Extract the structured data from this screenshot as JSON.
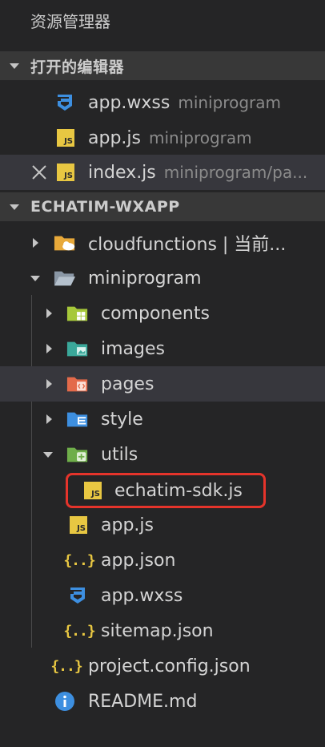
{
  "panel": {
    "title": "资源管理器"
  },
  "open_editors": {
    "section_label": "打开的编辑器",
    "items": [
      {
        "name": "app.wxss",
        "desc": "miniprogram",
        "icon": "css-file-icon"
      },
      {
        "name": "app.js",
        "desc": "miniprogram",
        "icon": "js-file-icon"
      },
      {
        "name": "index.js",
        "desc": "miniprogram/pa...",
        "icon": "js-file-icon"
      }
    ]
  },
  "workspace": {
    "section_label": "ECHATIM-WXAPP",
    "tree": [
      {
        "name": "cloudfunctions | 当前...",
        "type": "folder",
        "state": "collapsed",
        "icon": "cloud-folder-icon"
      },
      {
        "name": "miniprogram",
        "type": "folder",
        "state": "expanded",
        "icon": "folder-open-icon"
      },
      {
        "name": "components",
        "type": "folder",
        "state": "collapsed",
        "icon": "components-folder-icon"
      },
      {
        "name": "images",
        "type": "folder",
        "state": "collapsed",
        "icon": "images-folder-icon"
      },
      {
        "name": "pages",
        "type": "folder",
        "state": "collapsed",
        "icon": "pages-folder-icon"
      },
      {
        "name": "style",
        "type": "folder",
        "state": "collapsed",
        "icon": "style-folder-icon"
      },
      {
        "name": "utils",
        "type": "folder",
        "state": "expanded",
        "icon": "utils-folder-icon"
      },
      {
        "name": "echatim-sdk.js",
        "type": "file",
        "icon": "js-file-icon"
      },
      {
        "name": "app.js",
        "type": "file",
        "icon": "js-file-icon"
      },
      {
        "name": "app.json",
        "type": "file",
        "icon": "json-file-icon"
      },
      {
        "name": "app.wxss",
        "type": "file",
        "icon": "css-file-icon"
      },
      {
        "name": "sitemap.json",
        "type": "file",
        "icon": "json-file-icon"
      },
      {
        "name": "project.config.json",
        "type": "file",
        "icon": "json-file-icon"
      },
      {
        "name": "README.md",
        "type": "file",
        "icon": "info-file-icon"
      }
    ]
  },
  "badges": {
    "js": "JS",
    "json": "{..}"
  },
  "colors": {
    "background": "#252526",
    "section_bg": "#383838",
    "hover_bg": "#37373d",
    "js_yellow": "#e8c742",
    "css_blue": "#3d8fe0",
    "highlight_red": "#e5342b"
  }
}
